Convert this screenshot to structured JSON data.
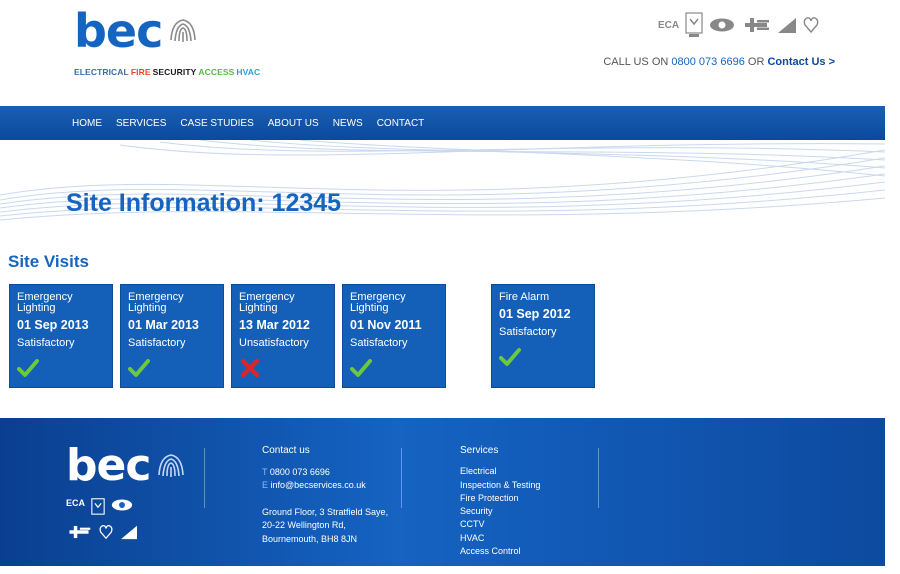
{
  "header": {
    "logo": "bec",
    "tagline": [
      {
        "text": "ELECTRICAL",
        "color": "#3a6ea5"
      },
      {
        "text": "FIRE",
        "color": "#e8452c"
      },
      {
        "text": "SECURITY",
        "color": "#1a1a1a"
      },
      {
        "text": "ACCESS",
        "color": "#57b947"
      },
      {
        "text": "HVAC",
        "color": "#2a9de0"
      }
    ],
    "accreditations": [
      "ECA"
    ],
    "call_prefix": "CALL US ON",
    "phone": "0800 073 6696",
    "or_text": "OR",
    "contact_link": "Contact Us >"
  },
  "nav": [
    "HOME",
    "SERVICES",
    "CASE STUDIES",
    "ABOUT US",
    "NEWS",
    "CONTACT"
  ],
  "page_title": "Site Information: 12345",
  "section_title": "Site Visits",
  "visits": [
    {
      "type": "Emergency Lighting",
      "date": "01 Sep 2013",
      "status": "Satisfactory",
      "result": "pass"
    },
    {
      "type": "Emergency Lighting",
      "date": "01 Mar 2013",
      "status": "Satisfactory",
      "result": "pass"
    },
    {
      "type": "Emergency Lighting",
      "date": "13 Mar 2012",
      "status": "Unsatisfactory",
      "result": "fail"
    },
    {
      "type": "Emergency Lighting",
      "date": "01 Nov 2011",
      "status": "Satisfactory",
      "result": "pass"
    },
    {
      "type": "Fire Alarm",
      "date": "01 Sep 2012",
      "status": "Satisfactory",
      "result": "pass"
    }
  ],
  "footer": {
    "logo": "bec",
    "accreditations": [
      "ECA"
    ],
    "contact": {
      "heading": "Contact us",
      "phone_prefix": "T",
      "phone": "0800 073 6696",
      "email_prefix": "E",
      "email": "info@becservices.co.uk",
      "address": [
        "Ground Floor, 3 Stratfield Saye,",
        "20-22 Wellington Rd,",
        "Bournemouth, BH8 8JN"
      ]
    },
    "services": {
      "heading": "Services",
      "items": [
        "Electrical",
        "Inspection & Testing",
        "Fire Protection",
        "Security",
        "CCTV",
        "HVAC",
        "Access Control"
      ]
    }
  },
  "colors": {
    "brand": "#1565c0",
    "card": "#1460b8",
    "pass": "#6cc93a",
    "fail": "#d8262b"
  }
}
